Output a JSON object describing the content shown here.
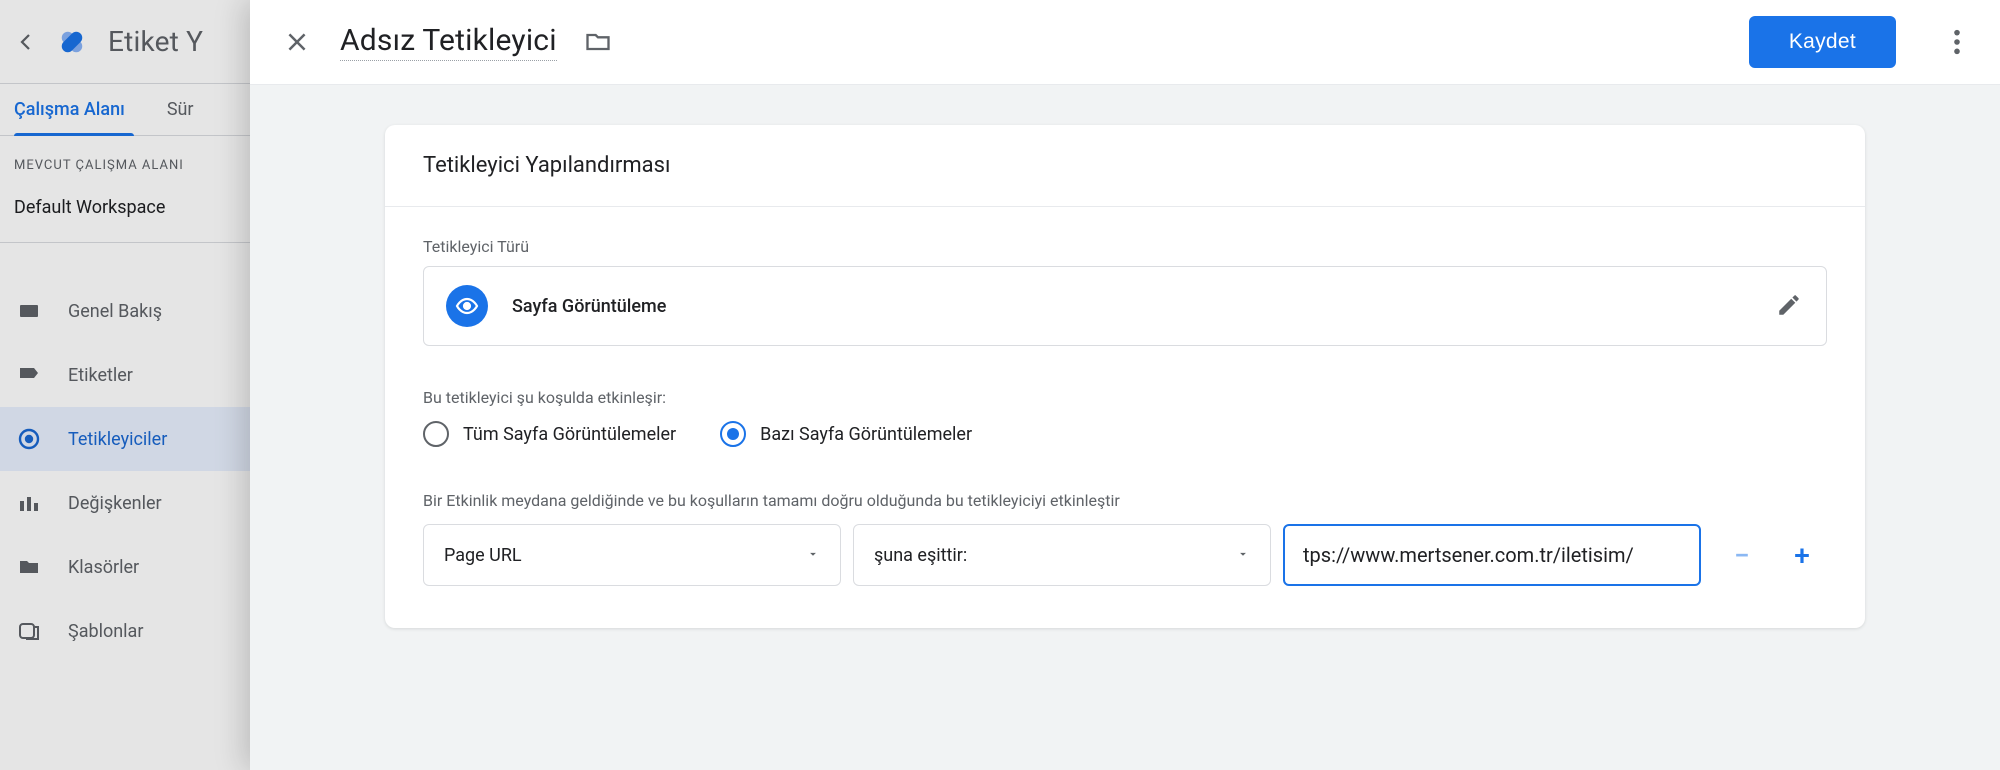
{
  "bg": {
    "title": "Etiket Y",
    "tabs": {
      "workspace": "Çalışma Alanı",
      "versions": "Sür"
    },
    "section_label": "MEVCUT ÇALIŞMA ALANI",
    "workspace_name": "Default Workspace",
    "nav": {
      "overview": "Genel Bakış",
      "tags": "Etiketler",
      "triggers": "Tetikleyiciler",
      "variables": "Değişkenler",
      "folders": "Klasörler",
      "templates": "Şablonlar"
    }
  },
  "panel": {
    "title": "Adsız Tetikleyici",
    "save": "Kaydet"
  },
  "card": {
    "heading": "Tetikleyici Yapılandırması",
    "type_label": "Tetikleyici Türü",
    "type_name": "Sayfa Görüntüleme",
    "fires_label": "Bu tetikleyici şu koşulda etkinleşir:",
    "radio_all": "Tüm Sayfa Görüntülemeler",
    "radio_some": "Bazı Sayfa Görüntülemeler",
    "condition_help": "Bir Etkinlik meydana geldiğinde ve bu koşulların tamamı doğru olduğunda bu tetikleyiciyi etkinleştir",
    "variable": "Page URL",
    "operator": "şuna eşittir:",
    "value": "tps://www.mertsener.com.tr/iletisim/"
  }
}
